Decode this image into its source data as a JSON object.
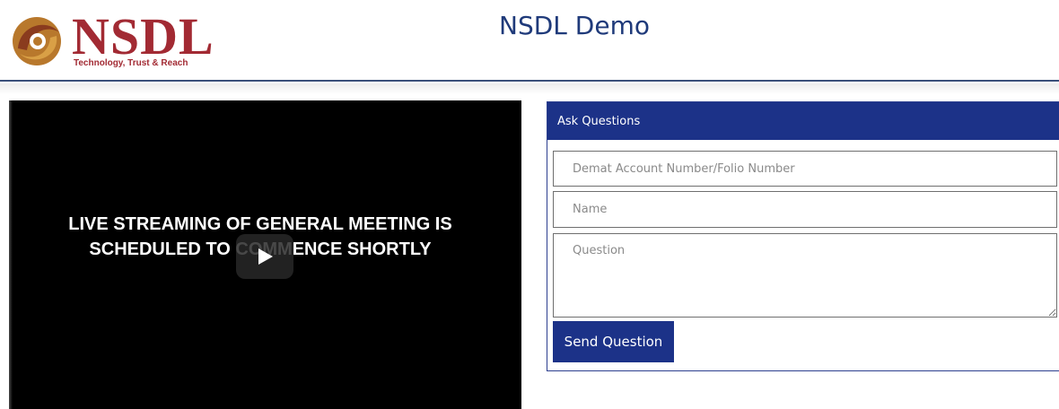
{
  "header": {
    "logo_text": "NSDL",
    "logo_tagline": "Technology, Trust & Reach",
    "site_title": "NSDL Demo"
  },
  "video": {
    "message": "LIVE STREAMING OF GENERAL MEETING IS SCHEDULED TO COMMENCE SHORTLY",
    "play_icon": "play-icon"
  },
  "form": {
    "title": "Ask Questions",
    "account_placeholder": "Demat Account Number/Folio Number",
    "account_value": "",
    "name_placeholder": "Name",
    "name_value": "",
    "question_placeholder": "Question",
    "question_value": "",
    "send_label": "Send Question"
  },
  "colors": {
    "brand_blue": "#1c3288",
    "logo_red": "#a22a33",
    "title_blue": "#1f3a7a"
  }
}
